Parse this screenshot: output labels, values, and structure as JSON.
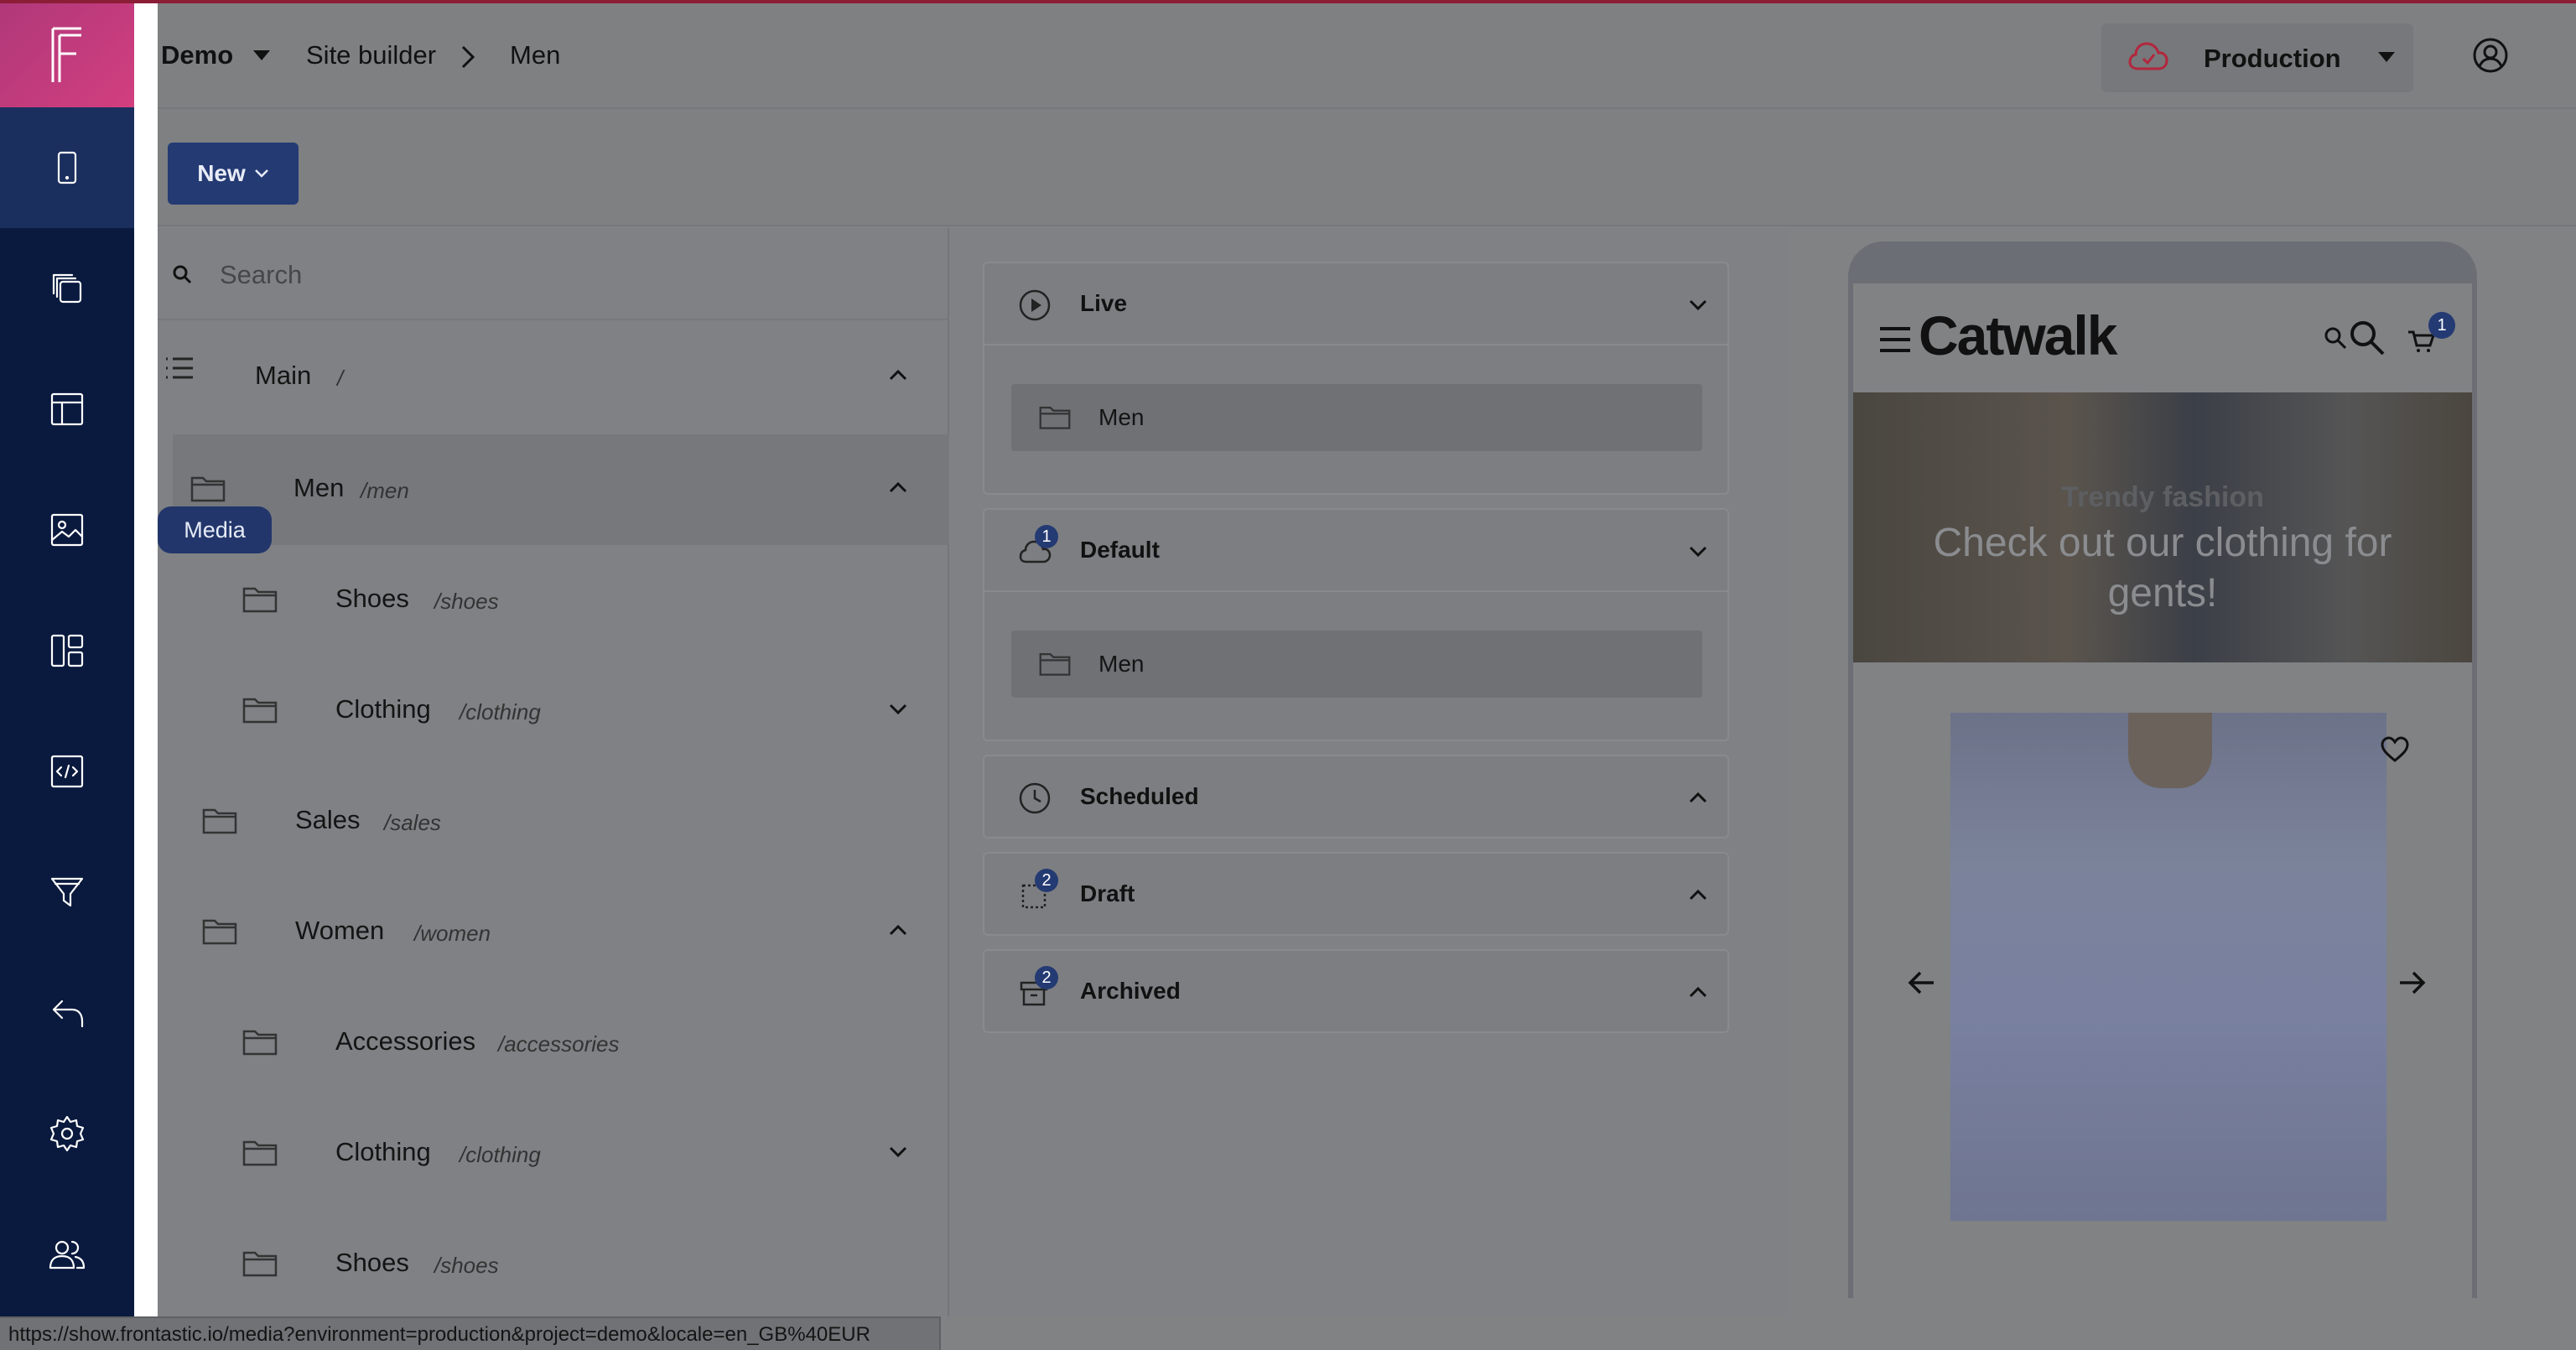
{
  "header": {
    "project": "Demo",
    "section": "Site builder",
    "current_page": "Men",
    "environment": "Production"
  },
  "toolbar": {
    "new_label": "New"
  },
  "search": {
    "placeholder": "Search"
  },
  "tree": {
    "items": [
      {
        "name": "Main",
        "path": "/"
      },
      {
        "name": "Men",
        "path": "/men"
      },
      {
        "name": "Shoes",
        "path": "/shoes"
      },
      {
        "name": "Clothing",
        "path": "/clothing"
      },
      {
        "name": "Sales",
        "path": "/sales"
      },
      {
        "name": "Women",
        "path": "/women"
      },
      {
        "name": "Accessories",
        "path": "/accessories"
      },
      {
        "name": "Clothing",
        "path": "/clothing"
      },
      {
        "name": "Shoes",
        "path": "/shoes"
      }
    ]
  },
  "tooltip": {
    "label": "Media"
  },
  "statuses": [
    {
      "title": "Live",
      "item": "Men"
    },
    {
      "title": "Default",
      "item": "Men",
      "badge": "1"
    },
    {
      "title": "Scheduled"
    },
    {
      "title": "Draft",
      "badge": "2"
    },
    {
      "title": "Archived",
      "badge": "2"
    }
  ],
  "preview": {
    "brand": "Catwalk",
    "cart_count": "1",
    "hero_subtitle": "Trendy fashion",
    "hero_title": "Check out our clothing for gents!"
  },
  "statusbar": {
    "url": "https://show.frontastic.io/media?environment=production&project=demo&locale=en_GB%40EUR"
  },
  "colors": {
    "sidebar": "#0a1a3e",
    "accent": "#243a73",
    "logo": "#d23f7f",
    "environment_icon": "#b3263c"
  }
}
